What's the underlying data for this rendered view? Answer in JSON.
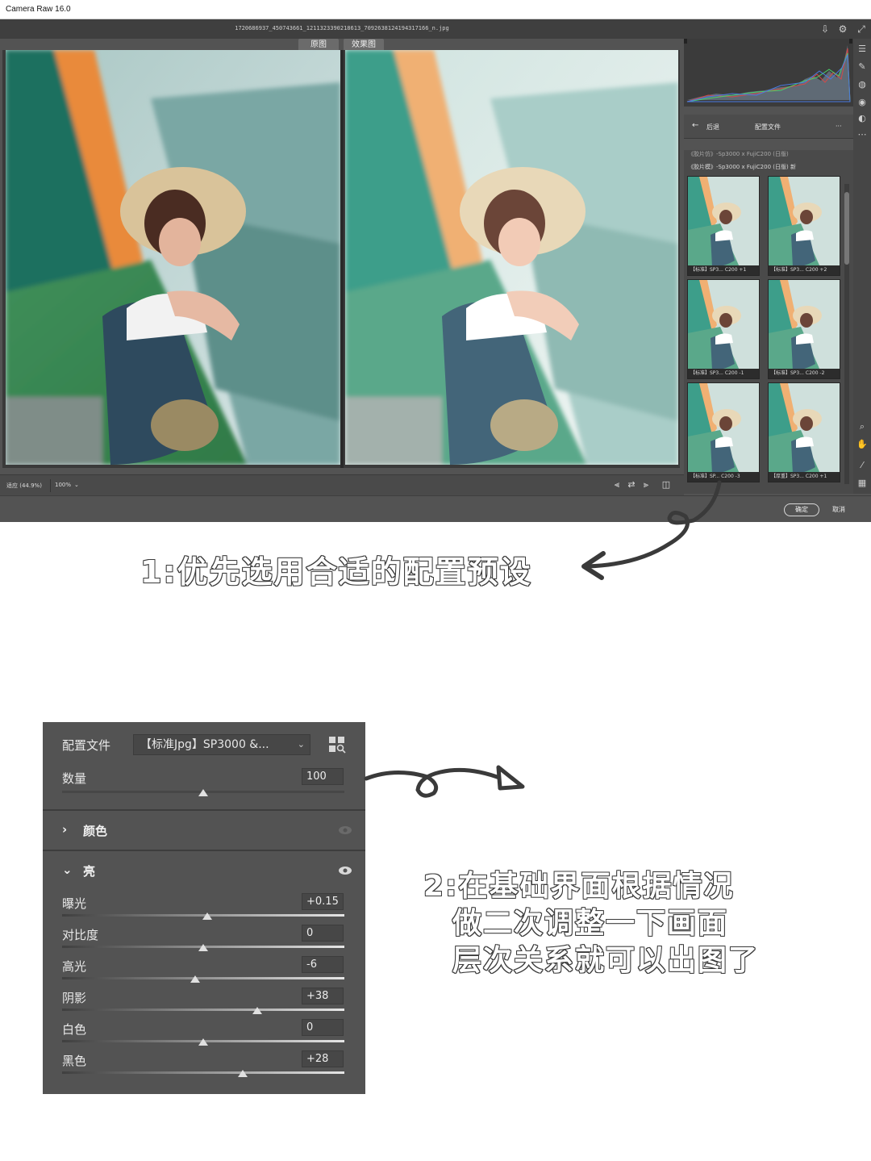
{
  "window": {
    "title": "Camera Raw 16.0",
    "filename": "1720686937_450743661_1211323390218613_7092638124194317166_n.jpg"
  },
  "view_tabs": {
    "before": "原图",
    "after": "效果图"
  },
  "bottom_bar": {
    "fit_zoom": "适应 (44.9%)",
    "zoom_100": "100%"
  },
  "presets": {
    "back": "后退",
    "title": "配置文件",
    "more": "···",
    "group_cut": "《胶片仿》-Sp3000 x FujiC200 (日版)",
    "group": "《胶片模》-Sp3000 x FujiC200 (日版) 新",
    "thumbs": [
      {
        "label": "【标准】SP3... C200 +1"
      },
      {
        "label": "【标准】SP3... C200 +2"
      },
      {
        "label": "【标准】SP3... C200 -1"
      },
      {
        "label": "【标准】SP3... C200 -2"
      },
      {
        "label": "【标准】SP... C200 -3"
      },
      {
        "label": "【厚重】SP3... C200 +1"
      }
    ]
  },
  "footer": {
    "ok": "确定",
    "cancel": "取消"
  },
  "caption1": "1:优先选用合适的配置预设",
  "caption2": {
    "line1": "2:在基础界面根据情况",
    "line2": "做二次调整一下画面",
    "line3": "层次关系就可以出图了"
  },
  "adjust": {
    "profile_label": "配置文件",
    "profile_value": "【标准Jpg】SP3000 &...",
    "amount_label": "数量",
    "amount_value": "100",
    "amount_level": 0.5,
    "color_section": "颜色",
    "light_section": "亮",
    "sliders": [
      {
        "label": "曝光",
        "value": "+0.15",
        "level": 0.515
      },
      {
        "label": "对比度",
        "value": "0",
        "level": 0.5
      },
      {
        "label": "高光",
        "value": "-6",
        "level": 0.47
      },
      {
        "label": "阴影",
        "value": "+38",
        "level": 0.69
      },
      {
        "label": "白色",
        "value": "0",
        "level": 0.5
      },
      {
        "label": "黑色",
        "value": "+28",
        "level": 0.64
      }
    ]
  },
  "colors": {
    "accent_arrow": "#3a3a3a",
    "panel": "#535353",
    "track_dark": "#3f3f3f",
    "track_light": "#e6e6e6"
  }
}
